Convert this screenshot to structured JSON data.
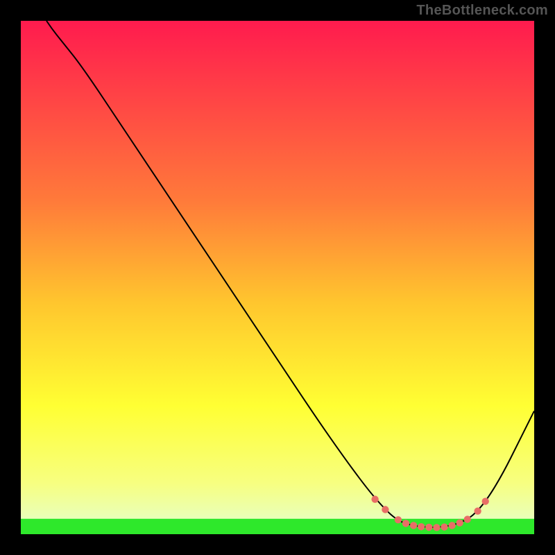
{
  "watermark": "TheBottleneck.com",
  "chart_data": {
    "type": "line",
    "title": "",
    "xlabel": "",
    "ylabel": "",
    "xlim": [
      0,
      100
    ],
    "ylim": [
      0,
      100
    ],
    "band": {
      "y_from": 0,
      "y_to": 3,
      "color": "#2ee82b"
    },
    "gradient_stops": [
      {
        "offset": 0,
        "color": "#ff1b4e"
      },
      {
        "offset": 35,
        "color": "#ff7a3a"
      },
      {
        "offset": 55,
        "color": "#ffc62e"
      },
      {
        "offset": 75,
        "color": "#ffff33"
      },
      {
        "offset": 90,
        "color": "#f7ff80"
      },
      {
        "offset": 97,
        "color": "#e9ffb9"
      },
      {
        "offset": 100,
        "color": "#2ee82b"
      }
    ],
    "curve_points": [
      {
        "x": 5,
        "y": 100
      },
      {
        "x": 6,
        "y": 98.5
      },
      {
        "x": 8,
        "y": 96
      },
      {
        "x": 12,
        "y": 91
      },
      {
        "x": 20,
        "y": 79
      },
      {
        "x": 30,
        "y": 64
      },
      {
        "x": 40,
        "y": 49
      },
      {
        "x": 50,
        "y": 34
      },
      {
        "x": 58,
        "y": 22
      },
      {
        "x": 64,
        "y": 13.5
      },
      {
        "x": 68,
        "y": 8.2
      },
      {
        "x": 71,
        "y": 4.8
      },
      {
        "x": 73,
        "y": 3
      },
      {
        "x": 75,
        "y": 2
      },
      {
        "x": 78,
        "y": 1.4
      },
      {
        "x": 81,
        "y": 1.3
      },
      {
        "x": 84,
        "y": 1.7
      },
      {
        "x": 86.5,
        "y": 2.6
      },
      {
        "x": 88.5,
        "y": 4
      },
      {
        "x": 91,
        "y": 7
      },
      {
        "x": 94,
        "y": 12
      },
      {
        "x": 97,
        "y": 18
      },
      {
        "x": 100,
        "y": 24
      }
    ],
    "highlight_dots": [
      {
        "x": 69,
        "y": 6.8
      },
      {
        "x": 71,
        "y": 4.8
      },
      {
        "x": 73.5,
        "y": 2.8
      },
      {
        "x": 75,
        "y": 2.1
      },
      {
        "x": 76.5,
        "y": 1.7
      },
      {
        "x": 78,
        "y": 1.45
      },
      {
        "x": 79.5,
        "y": 1.35
      },
      {
        "x": 81,
        "y": 1.3
      },
      {
        "x": 82.5,
        "y": 1.4
      },
      {
        "x": 84,
        "y": 1.7
      },
      {
        "x": 85.5,
        "y": 2.2
      },
      {
        "x": 87,
        "y": 2.9
      },
      {
        "x": 89,
        "y": 4.5
      },
      {
        "x": 90.5,
        "y": 6.4
      }
    ]
  }
}
